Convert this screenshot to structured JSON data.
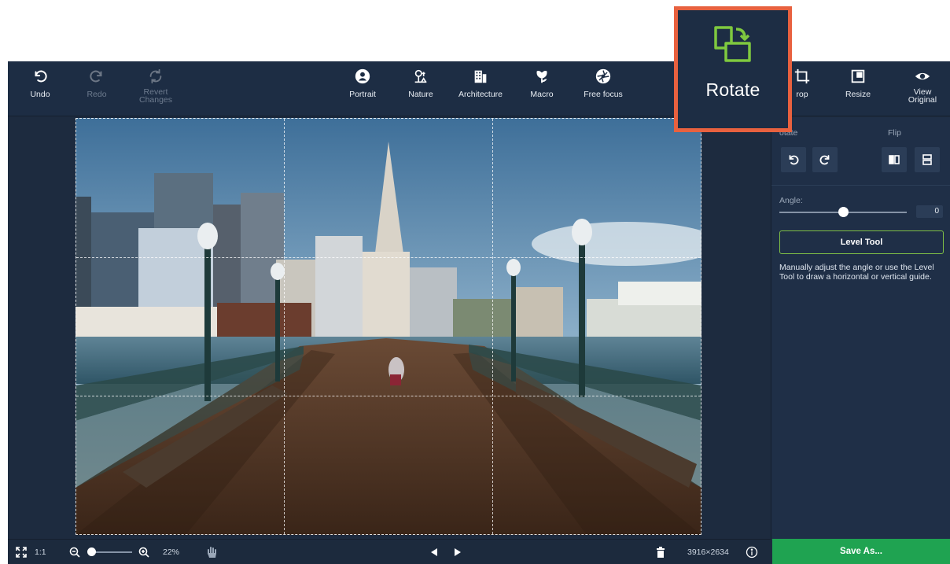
{
  "toolbar": {
    "undo": "Undo",
    "redo": "Redo",
    "revert": "Revert\nChanges",
    "portrait": "Portrait",
    "nature": "Nature",
    "architecture": "Architecture",
    "macro": "Macro",
    "free_focus": "Free focus",
    "crop": "rop",
    "resize": "Resize",
    "view_original": "View\nOriginal"
  },
  "callout": {
    "label": "Rotate",
    "icon": "rotate-icon",
    "border_color": "#e8613f"
  },
  "panel": {
    "rotate_head": "otate",
    "flip_head": "Flip",
    "angle_label": "Angle:",
    "angle_value": "0",
    "angle_slider": 0,
    "level_tool": "Level Tool",
    "help": "Manually adjust the angle or use the Level Tool to draw a horizontal or vertical guide."
  },
  "bottombar": {
    "one_to_one": "1:1",
    "zoom_percent": "22%",
    "dimensions": "3916×2634",
    "save_as": "Save As..."
  },
  "colors": {
    "accent_green": "#1fa351",
    "level_border": "#7fbf46",
    "toolbar_bg": "#1d2d44",
    "highlight": "#e8613f"
  }
}
